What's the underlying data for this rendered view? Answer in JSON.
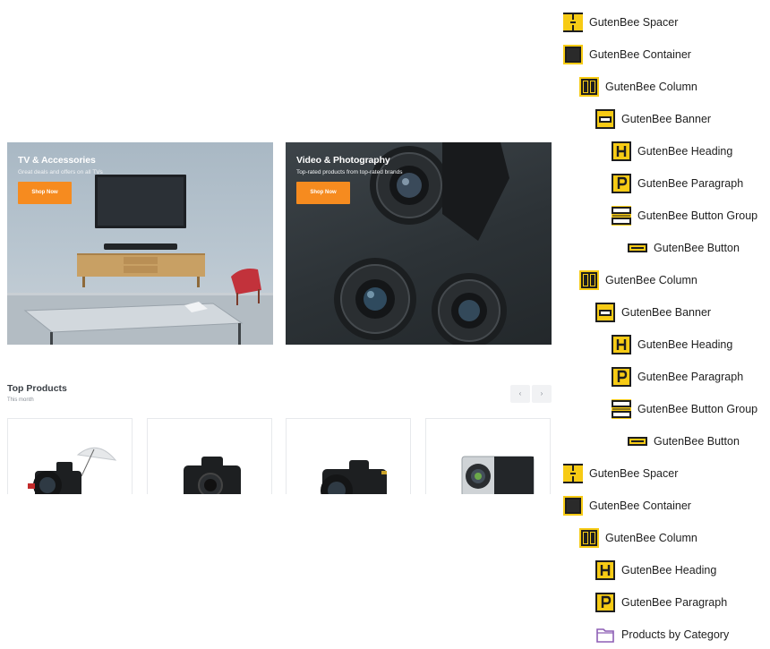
{
  "banners": [
    {
      "heading": "TV & Accessories",
      "paragraph": "Great deals and offers on all TVs",
      "button": "Shop Now"
    },
    {
      "heading": "Video & Photography",
      "paragraph": "Top-rated products from top-rated brands",
      "button": "Shop Now"
    }
  ],
  "products": {
    "title": "Top Products",
    "subtitle": "This month",
    "prev_icon": "‹",
    "next_icon": "›"
  },
  "block_list": [
    {
      "label": "GutenBee Spacer",
      "icon": "spacer-icon",
      "depth": 0
    },
    {
      "label": "GutenBee Container",
      "icon": "container-icon",
      "depth": 0
    },
    {
      "label": "GutenBee Column",
      "icon": "column-icon",
      "depth": 1
    },
    {
      "label": "GutenBee Banner",
      "icon": "banner-icon",
      "depth": 2
    },
    {
      "label": "GutenBee Heading",
      "icon": "heading-icon",
      "depth": 3
    },
    {
      "label": "GutenBee Paragraph",
      "icon": "paragraph-icon",
      "depth": 3
    },
    {
      "label": "GutenBee Button Group",
      "icon": "button-group-icon",
      "depth": 3
    },
    {
      "label": "GutenBee Button",
      "icon": "button-icon",
      "depth": 4
    },
    {
      "label": "GutenBee Column",
      "icon": "column-icon",
      "depth": 1
    },
    {
      "label": "GutenBee Banner",
      "icon": "banner-icon",
      "depth": 2
    },
    {
      "label": "GutenBee Heading",
      "icon": "heading-icon",
      "depth": 3
    },
    {
      "label": "GutenBee Paragraph",
      "icon": "paragraph-icon",
      "depth": 3
    },
    {
      "label": "GutenBee Button Group",
      "icon": "button-group-icon",
      "depth": 3
    },
    {
      "label": "GutenBee Button",
      "icon": "button-icon",
      "depth": 4
    },
    {
      "label": "GutenBee Spacer",
      "icon": "spacer-icon",
      "depth": 0
    },
    {
      "label": "GutenBee Container",
      "icon": "container-icon",
      "depth": 0
    },
    {
      "label": "GutenBee Column",
      "icon": "column-icon",
      "depth": 1
    },
    {
      "label": "GutenBee Heading",
      "icon": "heading-icon",
      "depth": 2
    },
    {
      "label": "GutenBee Paragraph",
      "icon": "paragraph-icon",
      "depth": 2
    },
    {
      "label": "Products by Category",
      "icon": "folder-icon",
      "depth": 2
    }
  ],
  "colors": {
    "icon_fill": "#f7cb15",
    "icon_stroke": "#1e1e1e",
    "folder_stroke": "#8d5fb5",
    "accent_button": "#f68b1f"
  }
}
